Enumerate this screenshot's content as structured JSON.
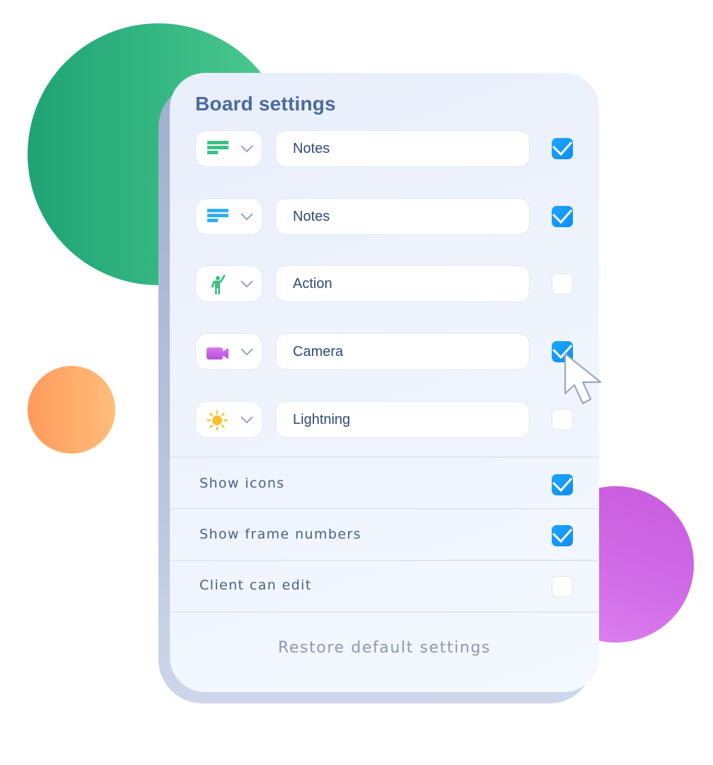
{
  "panel": {
    "title": "Board settings",
    "rows": [
      {
        "icon": "notes-icon",
        "icon_color": "#3fbf87",
        "label": "Notes",
        "checked": true
      },
      {
        "icon": "notes-icon",
        "icon_color": "#2fb0f5",
        "label": "Notes",
        "checked": true
      },
      {
        "icon": "action-figure-icon",
        "icon_color": "#3fbf87",
        "label": "Action",
        "checked": false
      },
      {
        "icon": "camera-icon",
        "icon_color": "#c25ae0",
        "label": "Camera",
        "checked": true
      },
      {
        "icon": "sun-icon",
        "icon_color": "#f7c02c",
        "label": "Lightning",
        "checked": false
      }
    ],
    "options": [
      {
        "label": "Show icons",
        "checked": true
      },
      {
        "label": "Show frame numbers",
        "checked": true
      },
      {
        "label": "Client can edit",
        "checked": false
      }
    ],
    "restore_label": "Restore default settings"
  },
  "colors": {
    "accent": "#1a9cfb",
    "title": "#4a6aa0",
    "green_blob": "#35b783",
    "orange_blob": "#ffae6b",
    "purple_blob": "#d06ae6"
  }
}
